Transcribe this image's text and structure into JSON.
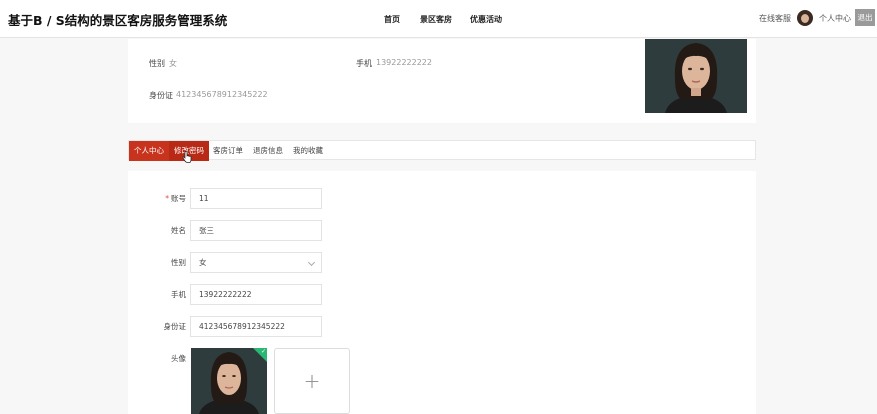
{
  "header": {
    "title": "基于B / S结构的景区客房服务管理系统",
    "nav": [
      {
        "label": "首页"
      },
      {
        "label": "景区客房"
      },
      {
        "label": "优惠活动"
      }
    ],
    "online_service": "在线客服",
    "user_center": "个人中心",
    "logout": "退出"
  },
  "profile": {
    "gender_label": "性别",
    "gender_value": "女",
    "phone_label": "手机",
    "phone_value": "13922222222",
    "id_label": "身份证",
    "id_value": "412345678912345222"
  },
  "tabs": [
    {
      "label": "个人中心",
      "active": true
    },
    {
      "label": "修改密码"
    },
    {
      "label": "客房订单"
    },
    {
      "label": "退房信息"
    },
    {
      "label": "我的收藏"
    }
  ],
  "form": {
    "account_label": "账号",
    "account_value": "11",
    "name_label": "姓名",
    "name_value": "张三",
    "gender_label": "性别",
    "gender_value": "女",
    "phone_label": "手机",
    "phone_value": "13922222222",
    "id_label": "身份证",
    "id_value": "412345678912345222",
    "avatar_label": "头像",
    "required_mark": "*",
    "upload_symbol": "+"
  },
  "colors": {
    "accent": "#c8331d",
    "success": "#2bb673"
  }
}
